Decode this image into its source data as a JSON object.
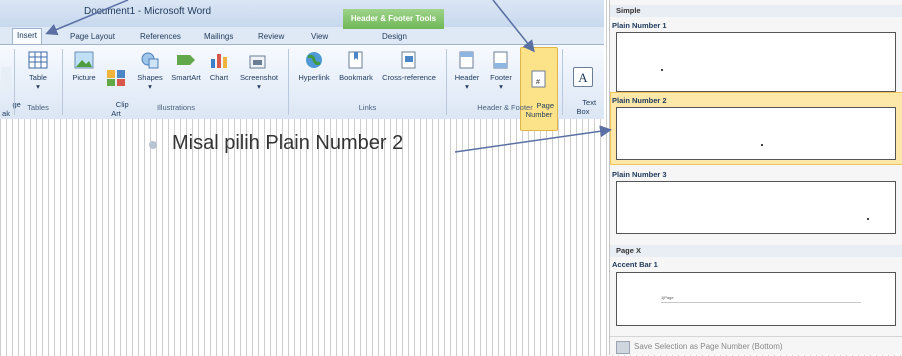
{
  "window": {
    "title": "Document1 - Microsoft Word",
    "context_tab_group": "Header & Footer Tools"
  },
  "tabs": [
    {
      "label": "Insert",
      "active": true
    },
    {
      "label": "Page Layout"
    },
    {
      "label": "References"
    },
    {
      "label": "Mailings"
    },
    {
      "label": "Review"
    },
    {
      "label": "View"
    },
    {
      "label": "Design"
    }
  ],
  "ribbon": {
    "partial_left": "ge\nak",
    "table": "Table",
    "tables_group": "Tables",
    "picture": "Picture",
    "clip_art": "Clip\nArt",
    "shapes": "Shapes",
    "smartart": "SmartArt",
    "chart": "Chart",
    "screenshot": "Screenshot",
    "illustrations_group": "Illustrations",
    "hyperlink": "Hyperlink",
    "bookmark": "Bookmark",
    "cross_reference": "Cross-reference",
    "links_group": "Links",
    "header": "Header",
    "footer": "Footer",
    "page_number": "Page\nNumber",
    "header_footer_group": "Header & Footer",
    "text_box": "Text\nBox"
  },
  "annotation": {
    "text": "Misal pilih Plain Number 2"
  },
  "gallery": {
    "section_simple": "Simple",
    "item1": "Plain Number 1",
    "item2": "Plain Number 2",
    "item3": "Plain Number 3",
    "section_page_x": "Page X",
    "item4": "Accent Bar 1",
    "accent_preview_text": "1|Page",
    "save_selection": "Save Selection as Page Number (Bottom)",
    "selected_item": "Plain Number 2"
  },
  "colors": {
    "selection": "#fde7a9",
    "ribbon": "#dfe9f5",
    "context_tab": "#8cc976",
    "arrow": "#5a6fa3"
  }
}
